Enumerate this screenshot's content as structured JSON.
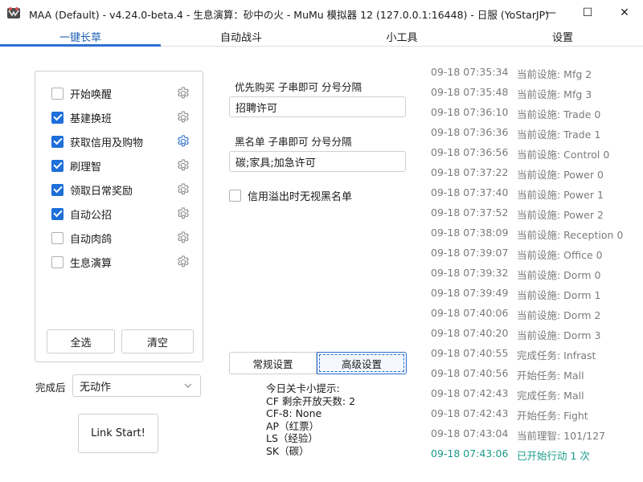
{
  "window": {
    "title": "MAA (Default) - v4.24.0-beta.4 - 生息演算：砂中の火 - MuMu 模拟器 12 (127.0.0.1:16448) - 日服 (YoStarJP)",
    "app_icon": "maa-logo-icon",
    "minimize_glyph": "—",
    "maximize_glyph": "☐",
    "close_glyph": "✕"
  },
  "tabs": [
    {
      "label": "一键长草",
      "active": true
    },
    {
      "label": "自动战斗",
      "active": false
    },
    {
      "label": "小工具",
      "active": false
    },
    {
      "label": "设置",
      "active": false
    }
  ],
  "tasks": [
    {
      "label": "开始唤醒",
      "checked": false,
      "gear_active": false
    },
    {
      "label": "基建换班",
      "checked": true,
      "gear_active": false
    },
    {
      "label": "获取信用及购物",
      "checked": true,
      "gear_active": true
    },
    {
      "label": "刷理智",
      "checked": true,
      "gear_active": false
    },
    {
      "label": "领取日常奖励",
      "checked": true,
      "gear_active": false
    },
    {
      "label": "自动公招",
      "checked": true,
      "gear_active": false
    },
    {
      "label": "自动肉鸽",
      "checked": false,
      "gear_active": false
    },
    {
      "label": "生息演算",
      "checked": false,
      "gear_active": false
    }
  ],
  "task_buttons": {
    "select_all": "全选",
    "clear": "清空"
  },
  "after_complete": {
    "label": "完成后",
    "value": "无动作"
  },
  "link_start": "Link Start!",
  "shop": {
    "priority_label": "优先购买 子串即可 分号分隔",
    "priority_value": "招聘许可",
    "blacklist_label": "黑名单 子串即可 分号分隔",
    "blacklist_value": "碳;家具;加急许可",
    "overflow_label": "信用溢出时无视黑名单",
    "overflow_checked": false
  },
  "modes": {
    "normal": "常规设置",
    "advanced": "高级设置"
  },
  "tips": [
    "今日关卡小提示:",
    "CF 剩余开放天数: 2",
    "CF-8: None",
    "AP（红票）",
    "LS（经验）",
    "SK（碳）"
  ],
  "log": [
    {
      "time": "09-18  07:35:34",
      "msg": "当前设施: Mfg 2",
      "color": "#7a7a7a"
    },
    {
      "time": "09-18  07:35:48",
      "msg": "当前设施: Mfg 3",
      "color": "#7a7a7a"
    },
    {
      "time": "09-18  07:36:10",
      "msg": "当前设施: Trade 0",
      "color": "#7a7a7a"
    },
    {
      "time": "09-18  07:36:36",
      "msg": "当前设施: Trade 1",
      "color": "#7a7a7a"
    },
    {
      "time": "09-18  07:36:56",
      "msg": "当前设施: Control 0",
      "color": "#7a7a7a"
    },
    {
      "time": "09-18  07:37:22",
      "msg": "当前设施: Power 0",
      "color": "#7a7a7a"
    },
    {
      "time": "09-18  07:37:40",
      "msg": "当前设施: Power 1",
      "color": "#7a7a7a"
    },
    {
      "time": "09-18  07:37:52",
      "msg": "当前设施: Power 2",
      "color": "#7a7a7a"
    },
    {
      "time": "09-18  07:38:09",
      "msg": "当前设施: Reception 0",
      "color": "#7a7a7a"
    },
    {
      "time": "09-18  07:39:07",
      "msg": "当前设施: Office 0",
      "color": "#7a7a7a"
    },
    {
      "time": "09-18  07:39:32",
      "msg": "当前设施: Dorm 0",
      "color": "#7a7a7a"
    },
    {
      "time": "09-18  07:39:49",
      "msg": "当前设施: Dorm 1",
      "color": "#7a7a7a"
    },
    {
      "time": "09-18  07:40:06",
      "msg": "当前设施: Dorm 2",
      "color": "#7a7a7a"
    },
    {
      "time": "09-18  07:40:20",
      "msg": "当前设施: Dorm 3",
      "color": "#7a7a7a"
    },
    {
      "time": "09-18  07:40:55",
      "msg": "完成任务: Infrast",
      "color": "#7a7a7a"
    },
    {
      "time": "09-18  07:40:56",
      "msg": "开始任务: Mall",
      "color": "#7a7a7a"
    },
    {
      "time": "09-18  07:42:43",
      "msg": "完成任务: Mall",
      "color": "#7a7a7a"
    },
    {
      "time": "09-18  07:42:43",
      "msg": "开始任务: Fight",
      "color": "#7a7a7a"
    },
    {
      "time": "09-18  07:43:04",
      "msg": "当前理智: 101/127",
      "color": "#7a7a7a"
    },
    {
      "time": "09-18  07:43:06",
      "msg": "已开始行动 1 次",
      "color": "#1a9a8a"
    }
  ]
}
